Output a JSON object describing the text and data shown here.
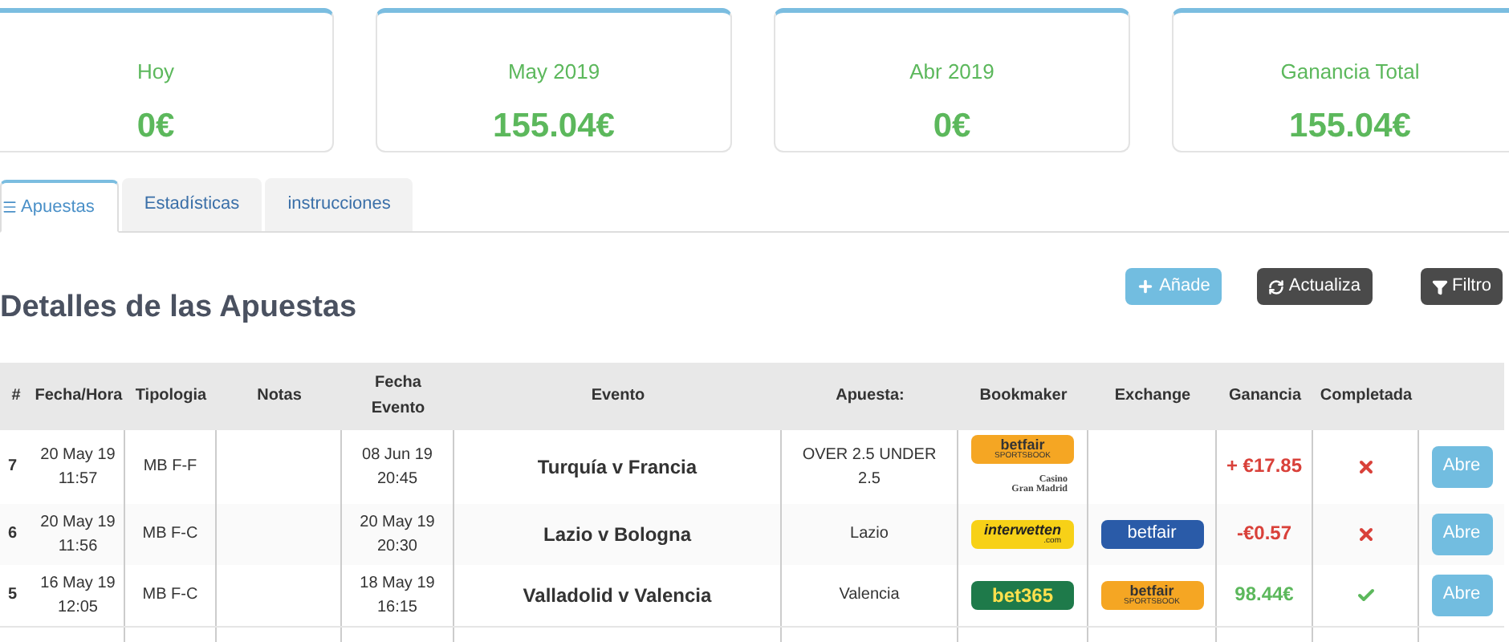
{
  "summary_cards": [
    {
      "label": "Hoy",
      "value": "0€"
    },
    {
      "label": "May 2019",
      "value": "155.04€"
    },
    {
      "label": "Abr 2019",
      "value": "0€"
    },
    {
      "label": "Ganancia Total",
      "value": "155.04€"
    }
  ],
  "tabs": [
    {
      "label": "Apuestas",
      "selected": true
    },
    {
      "label": "Estadísticas",
      "selected": false
    },
    {
      "label": "instrucciones",
      "selected": false
    }
  ],
  "heading": "Detalles de las Apuestas",
  "toolbar": [
    {
      "kind": "add",
      "label": "Añade"
    },
    {
      "kind": "refresh",
      "label": "Actualiza"
    },
    {
      "kind": "filter",
      "label": "Filtro"
    }
  ],
  "table": {
    "columns": [
      "#",
      "Fecha/Hora",
      "Tipologia",
      "Notas",
      "Fecha Evento",
      "Evento",
      "Apuesta:",
      "Bookmaker",
      "Exchange",
      "Ganancia",
      "Completada"
    ],
    "rows": [
      {
        "id": "7",
        "date": [
          "20 May 19",
          "11:57"
        ],
        "type": "MB F-F",
        "notes": "",
        "event_date": [
          "08 Jun 19",
          "20:45"
        ],
        "event": "Turquía v Francia",
        "bet": "OVER 2.5 UNDER 2.5",
        "bookmaker": [
          {
            "kind": "betfair_sb",
            "lines": [
              "betfair",
              "SPORTSBOOK"
            ]
          },
          {
            "kind": "casino",
            "lines": [
              "Casino",
              "Gran Madrid"
            ]
          }
        ],
        "exchange": [],
        "profit": "+ €17.85",
        "positive": false,
        "completed": false,
        "action": "Abre"
      },
      {
        "id": "6",
        "date": [
          "20 May 19",
          "11:56"
        ],
        "type": "MB F-C",
        "notes": "",
        "event_date": [
          "20 May 19",
          "20:30"
        ],
        "event": "Lazio v Bologna",
        "bet": "Lazio",
        "bookmaker": [
          {
            "kind": "interwetten",
            "lines": [
              "interwetten",
              ".com"
            ]
          }
        ],
        "exchange": [
          {
            "kind": "betfair",
            "lines": [
              "betfair"
            ]
          }
        ],
        "profit": "-€0.57",
        "positive": false,
        "completed": false,
        "action": "Abre"
      },
      {
        "id": "5",
        "date": [
          "16 May 19",
          "12:05"
        ],
        "type": "MB F-C",
        "notes": "",
        "event_date": [
          "18 May 19",
          "16:15"
        ],
        "event": "Valladolid v Valencia",
        "bet": "Valencia",
        "bookmaker": [
          {
            "kind": "bet365",
            "lines": [
              "bet365"
            ]
          }
        ],
        "exchange": [
          {
            "kind": "betfair_sb",
            "lines": [
              "betfair",
              "SPORTSBOOK"
            ]
          }
        ],
        "profit": "98.44€",
        "positive": true,
        "completed": true,
        "action": "Abre"
      }
    ]
  }
}
